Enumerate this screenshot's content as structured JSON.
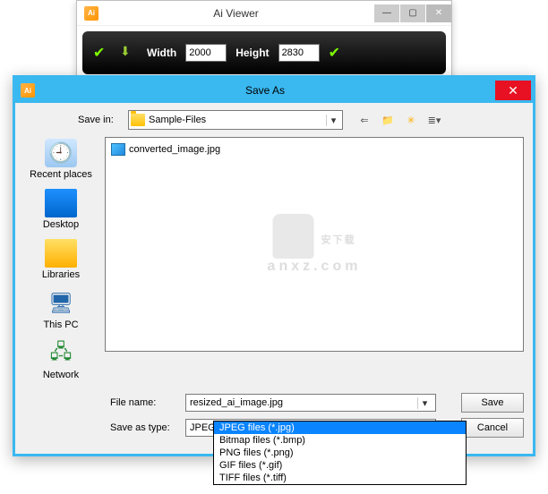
{
  "aiViewer": {
    "title": "Ai Viewer",
    "iconText": "Ai",
    "widthLabel": "Width",
    "widthValue": "2000",
    "heightLabel": "Height",
    "heightValue": "2830"
  },
  "saveAs": {
    "title": "Save As",
    "iconText": "Ai",
    "saveInLabel": "Save in:",
    "saveInValue": "Sample-Files",
    "sidebar": [
      {
        "label": "Recent places"
      },
      {
        "label": "Desktop"
      },
      {
        "label": "Libraries"
      },
      {
        "label": "This PC"
      },
      {
        "label": "Network"
      }
    ],
    "fileList": [
      {
        "name": "converted_image.jpg"
      }
    ],
    "watermark": {
      "line1": "安下载",
      "line2": "anxz.com"
    },
    "fileNameLabel": "File name:",
    "fileNameValue": "resized_ai_image.jpg",
    "saveTypeLabel": "Save as type:",
    "saveTypeValue": "JPEG files (*.jpg)",
    "typeOptions": [
      "JPEG files (*.jpg)",
      "Bitmap files (*.bmp)",
      "PNG files (*.png)",
      "GIF files (*.gif)",
      "TIFF files (*.tiff)"
    ],
    "saveButton": "Save",
    "cancelButton": "Cancel"
  }
}
